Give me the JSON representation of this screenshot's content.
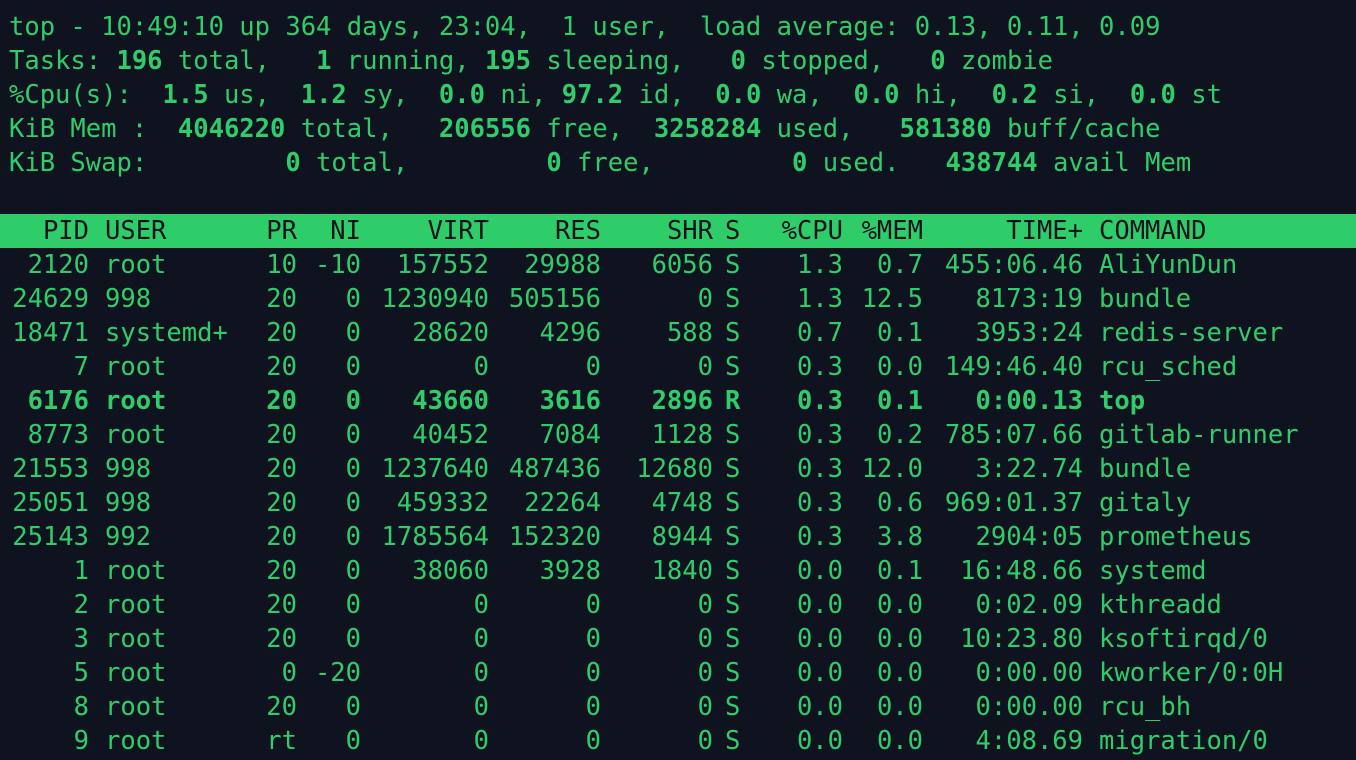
{
  "summary": {
    "uptime_line": "top - 10:49:10 up 364 days, 23:04,  1 user,  load average: 0.13, 0.11, 0.09",
    "tasks": {
      "prefix": "Tasks: ",
      "total": "196",
      "total_label": " total,   ",
      "running": "1",
      "running_label": " running, ",
      "sleeping": "195",
      "sleeping_label": " sleeping,   ",
      "stopped": "0",
      "stopped_label": " stopped,   ",
      "zombie": "0",
      "zombie_label": " zombie"
    },
    "cpu": {
      "prefix": "%Cpu(s):  ",
      "us": "1.5",
      "us_label": " us,  ",
      "sy": "1.2",
      "sy_label": " sy,  ",
      "ni": "0.0",
      "ni_label": " ni, ",
      "id": "97.2",
      "id_label": " id,  ",
      "wa": "0.0",
      "wa_label": " wa,  ",
      "hi": "0.0",
      "hi_label": " hi,  ",
      "si": "0.2",
      "si_label": " si,  ",
      "st": "0.0",
      "st_label": " st"
    },
    "mem": {
      "prefix": "KiB Mem :  ",
      "total": "4046220",
      "total_label": " total,   ",
      "free": "206556",
      "free_label": " free,  ",
      "used": "3258284",
      "used_label": " used,   ",
      "buff": "581380",
      "buff_label": " buff/cache"
    },
    "swap": {
      "prefix": "KiB Swap:         ",
      "total": "0",
      "total_label": " total,         ",
      "free": "0",
      "free_label": " free,         ",
      "used": "0",
      "used_label": " used.   ",
      "avail": "438744",
      "avail_label": " avail Mem"
    }
  },
  "table": {
    "columns": [
      "PID",
      "USER",
      "PR",
      "NI",
      "VIRT",
      "RES",
      "SHR",
      "S",
      "%CPU",
      "%MEM",
      "TIME+",
      "COMMAND"
    ],
    "rows": [
      [
        "2120",
        "root",
        "10",
        "-10",
        "157552",
        "29988",
        "6056",
        "S",
        "1.3",
        "0.7",
        "455:06.46",
        "AliYunDun"
      ],
      [
        "24629",
        "998",
        "20",
        "0",
        "1230940",
        "505156",
        "0",
        "S",
        "1.3",
        "12.5",
        "8173:19",
        "bundle"
      ],
      [
        "18471",
        "systemd+",
        "20",
        "0",
        "28620",
        "4296",
        "588",
        "S",
        "0.7",
        "0.1",
        "3953:24",
        "redis-server"
      ],
      [
        "7",
        "root",
        "20",
        "0",
        "0",
        "0",
        "0",
        "S",
        "0.3",
        "0.0",
        "149:46.40",
        "rcu_sched"
      ],
      [
        "6176",
        "root",
        "20",
        "0",
        "43660",
        "3616",
        "2896",
        "R",
        "0.3",
        "0.1",
        "0:00.13",
        "top"
      ],
      [
        "8773",
        "root",
        "20",
        "0",
        "40452",
        "7084",
        "1128",
        "S",
        "0.3",
        "0.2",
        "785:07.66",
        "gitlab-runner"
      ],
      [
        "21553",
        "998",
        "20",
        "0",
        "1237640",
        "487436",
        "12680",
        "S",
        "0.3",
        "12.0",
        "3:22.74",
        "bundle"
      ],
      [
        "25051",
        "998",
        "20",
        "0",
        "459332",
        "22264",
        "4748",
        "S",
        "0.3",
        "0.6",
        "969:01.37",
        "gitaly"
      ],
      [
        "25143",
        "992",
        "20",
        "0",
        "1785564",
        "152320",
        "8944",
        "S",
        "0.3",
        "3.8",
        "2904:05",
        "prometheus"
      ],
      [
        "1",
        "root",
        "20",
        "0",
        "38060",
        "3928",
        "1840",
        "S",
        "0.0",
        "0.1",
        "16:48.66",
        "systemd"
      ],
      [
        "2",
        "root",
        "20",
        "0",
        "0",
        "0",
        "0",
        "S",
        "0.0",
        "0.0",
        "0:02.09",
        "kthreadd"
      ],
      [
        "3",
        "root",
        "20",
        "0",
        "0",
        "0",
        "0",
        "S",
        "0.0",
        "0.0",
        "10:23.80",
        "ksoftirqd/0"
      ],
      [
        "5",
        "root",
        "0",
        "-20",
        "0",
        "0",
        "0",
        "S",
        "0.0",
        "0.0",
        "0:00.00",
        "kworker/0:0H"
      ],
      [
        "8",
        "root",
        "20",
        "0",
        "0",
        "0",
        "0",
        "S",
        "0.0",
        "0.0",
        "0:00.00",
        "rcu_bh"
      ],
      [
        "9",
        "root",
        "rt",
        "0",
        "0",
        "0",
        "0",
        "S",
        "0.0",
        "0.0",
        "4:08.69",
        "migration/0"
      ]
    ],
    "bold_row_index": 4
  },
  "colors": {
    "background": "#0f1320",
    "foreground": "#2fcd6a",
    "header_bg": "#2fcd6a",
    "header_fg": "#0f1320"
  }
}
